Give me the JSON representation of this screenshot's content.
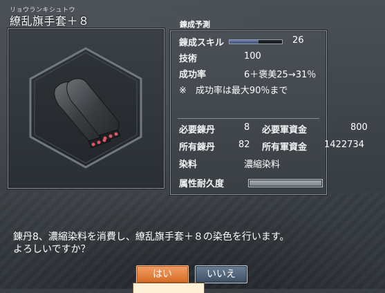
{
  "item": {
    "furigana": "リョウランキシュトウ",
    "name": "繚乱旗手套＋８"
  },
  "result": {
    "title": "錬成予測",
    "skill_label": "錬成スキル",
    "skill_value": "26",
    "skill_fraction": 0.55,
    "technique_label": "技術",
    "technique_value": "100",
    "success_label": "成功率",
    "success_value": "6＋褒美25→31％",
    "note": "※　成功率は最大90％まで",
    "required_tan_label": "必要錬丹",
    "required_tan_value": "8",
    "required_funds_label": "必要軍資金",
    "required_funds_value": "800",
    "owned_tan_label": "所有錬丹",
    "owned_tan_value": "82",
    "owned_funds_label": "所有軍資金",
    "owned_funds_value": "1422734",
    "dye_label": "染料",
    "dye_value": "濃縮染料",
    "durability_label": "属性耐久度",
    "durability_fraction": 1.0
  },
  "dialog": {
    "line1": "錬丹8、濃縮染料を消費し、繚乱旗手套＋８の染色を行います。",
    "line2": "よろしいですか？",
    "yes_label": "はい",
    "no_label": "いいえ"
  },
  "colors": {
    "yes_button": "#d46b23",
    "no_button": "#3d4f63",
    "glove_accent": "#e05566"
  }
}
